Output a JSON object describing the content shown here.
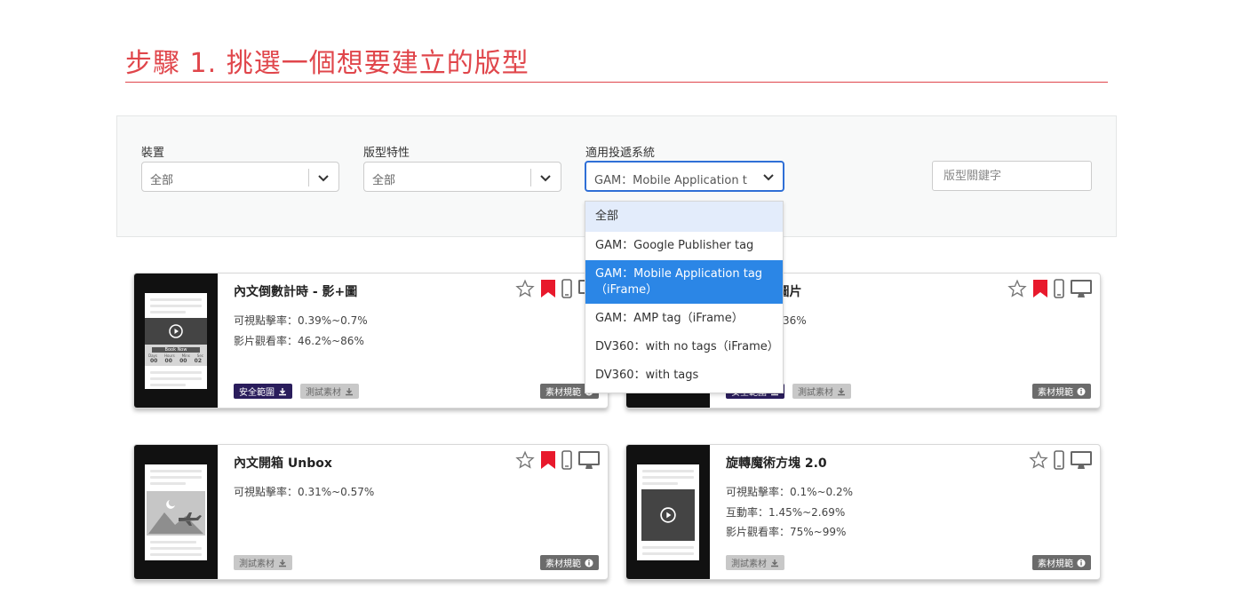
{
  "step_title": "步驟 1. 挑選一個想要建立的版型",
  "filters": {
    "device": {
      "label": "裝置",
      "value": "全部"
    },
    "feature": {
      "label": "版型特性",
      "value": "全部"
    },
    "system": {
      "label": "適用投遞系統",
      "value": "GAM：Mobile Application t..."
    },
    "keyword": {
      "placeholder": "版型關鍵字"
    }
  },
  "dropdown": {
    "options": [
      "全部",
      "GAM：Google Publisher tag",
      "GAM：Mobile Application tag（iFrame）",
      "GAM：AMP tag（iFrame）",
      "DV360：with no tags（iFrame）",
      "DV360：with tags"
    ],
    "selected_index": 2,
    "hover_index": 0
  },
  "cards": [
    {
      "title": "內文倒數計時 - 影+圖",
      "stats": [
        "可視點擊率：0.39%~0.7%",
        "影片觀看率：46.2%~86%"
      ],
      "badges": {
        "safe": "安全範圍",
        "test": "測試素材",
        "spec": "素材規範"
      },
      "icons": [
        "star-icon",
        "bookmark-icon",
        "mobile-icon",
        "desktop-icon"
      ]
    },
    {
      "title": "計時 - 僅圖片",
      "stats": [
        "：0.2%~0.36%"
      ],
      "badges": {
        "safe": "安全範圍",
        "test": "測試素材",
        "spec": "素材規範"
      },
      "icons": [
        "star-icon",
        "bookmark-icon",
        "mobile-icon",
        "desktop-icon"
      ]
    },
    {
      "title": "內文開箱 Unbox",
      "stats": [
        "可視點擊率：0.31%~0.57%"
      ],
      "badges": {
        "test": "測試素材",
        "spec": "素材規範"
      },
      "icons": [
        "star-icon",
        "bookmark-icon",
        "mobile-icon",
        "desktop-icon"
      ]
    },
    {
      "title": "旋轉魔術方塊 2.0",
      "stats": [
        "可視點擊率：0.1%~0.2%",
        "互動率：1.45%~2.69%",
        "影片觀看率：75%~99%"
      ],
      "badges": {
        "test": "測試素材",
        "spec": "素材規範"
      },
      "icons": [
        "star-icon",
        "mobile-icon",
        "desktop-icon"
      ]
    }
  ],
  "countdown_thumb": {
    "cta": "Book Now",
    "units": [
      "Days",
      "Hours",
      "Mins",
      "Sec"
    ],
    "digits": [
      "00",
      "00",
      "00",
      "02"
    ]
  },
  "colors": {
    "accent": "#e0464b",
    "select_focus": "#2f6fd6",
    "option_selected": "#2b86e6",
    "bookmark": "#e8192c",
    "safe_badge": "#2a1d5c"
  }
}
